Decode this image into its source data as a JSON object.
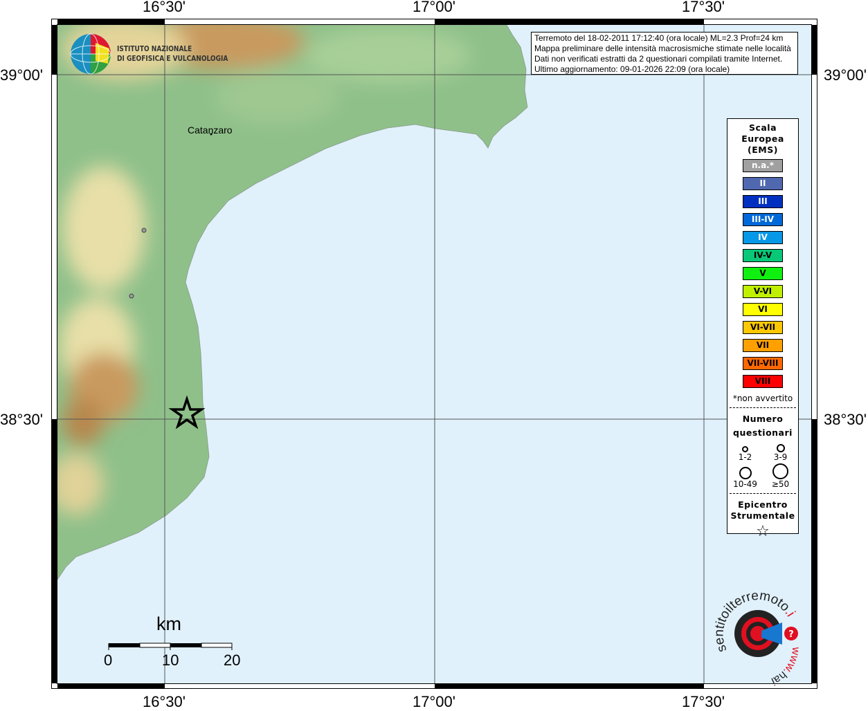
{
  "map": {
    "longitude_labels": [
      "16°30'",
      "17°00'",
      "17°30'"
    ],
    "latitude_labels": [
      "39°00'",
      "38°30'"
    ],
    "colors": {
      "sea": "#e0f1fc",
      "lowland": "#8fc08a",
      "hills": "#e8dfa8",
      "mountains": "#c99a5e"
    },
    "city_label": "Catanzaro",
    "epicenter_icon": "star-icon"
  },
  "logo_ingv": {
    "line1": "ISTITUTO NAZIONALE",
    "line2": "DI GEOFISICA E VULCANOLOGIA"
  },
  "logo_hsit": {
    "text": "www.haisentitoilterremoto.it"
  },
  "info": {
    "line1": "Terremoto del 18-02-2011 17:12:40 (ora locale) ML=2.3 Prof=24 km",
    "line2": "Mappa preliminare delle intensità macrosismiche stimate nelle località",
    "line3": "Dati non verificati estratti da 2 questionari compilati tramite Internet.",
    "line4": "Ultimo aggiornamento: 09-01-2026 22:09 (ora locale)"
  },
  "legend": {
    "title1": "Scala",
    "title2": "Europea",
    "title3": "(EMS)",
    "scale": [
      {
        "label": "n.a.*",
        "color": "#a0a0a0",
        "text": "#ffffff"
      },
      {
        "label": "II",
        "color": "#5068b0",
        "text": "#ffffff"
      },
      {
        "label": "III",
        "color": "#0030c0",
        "text": "#ffffff"
      },
      {
        "label": "III-IV",
        "color": "#0068d8",
        "text": "#ffffff"
      },
      {
        "label": "IV",
        "color": "#0898e8",
        "text": "#ffffff"
      },
      {
        "label": "IV-V",
        "color": "#08c878",
        "text": "#000000"
      },
      {
        "label": "V",
        "color": "#10f010",
        "text": "#000000"
      },
      {
        "label": "V-VI",
        "color": "#c0f000",
        "text": "#000000"
      },
      {
        "label": "VI",
        "color": "#ffff00",
        "text": "#000000"
      },
      {
        "label": "VI-VII",
        "color": "#ffc800",
        "text": "#000000"
      },
      {
        "label": "VII",
        "color": "#ffa000",
        "text": "#000000"
      },
      {
        "label": "VII-VIII",
        "color": "#ff6800",
        "text": "#000000"
      },
      {
        "label": "VIII",
        "color": "#ff0000",
        "text": "#000000"
      }
    ],
    "note": "*non avvertito",
    "count_title1": "Numero",
    "count_title2": "questionari",
    "counts": [
      "1-2",
      "3-9",
      "10-49",
      "≥50"
    ],
    "epi_title1": "Epicentro",
    "epi_title2": "Strumentale"
  },
  "scalebar": {
    "unit": "km",
    "labels": [
      "0",
      "10",
      "20"
    ]
  }
}
